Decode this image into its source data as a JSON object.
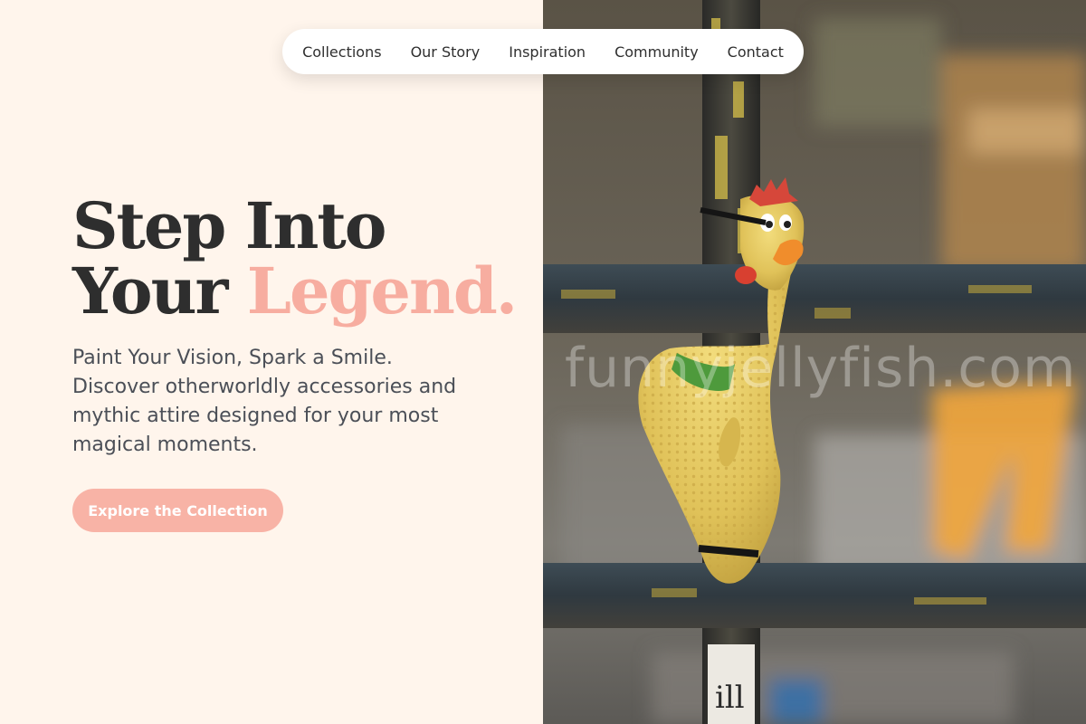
{
  "nav": {
    "items": [
      "Collections",
      "Our Story",
      "Inspiration",
      "Community",
      "Contact"
    ]
  },
  "hero": {
    "title_line1": "Step Into",
    "title_line2_plain": "Your",
    "title_line2_accent": "Legend.",
    "subtitle": "Paint Your Vision, Spark a Smile. Discover otherworldly accessories and mythic attire designed for your most magical moments.",
    "cta_label": "Explore the Collection"
  },
  "photo": {
    "watermark": "funnyjellyfish.com",
    "subject": "rubber chicken toy on rusty metal railing"
  },
  "colors": {
    "background": "#fff5ec",
    "accent": "#f7ada0",
    "button": "#f8b3a6",
    "text_dark": "#2e2e2e",
    "text_body": "#4b4f57"
  }
}
